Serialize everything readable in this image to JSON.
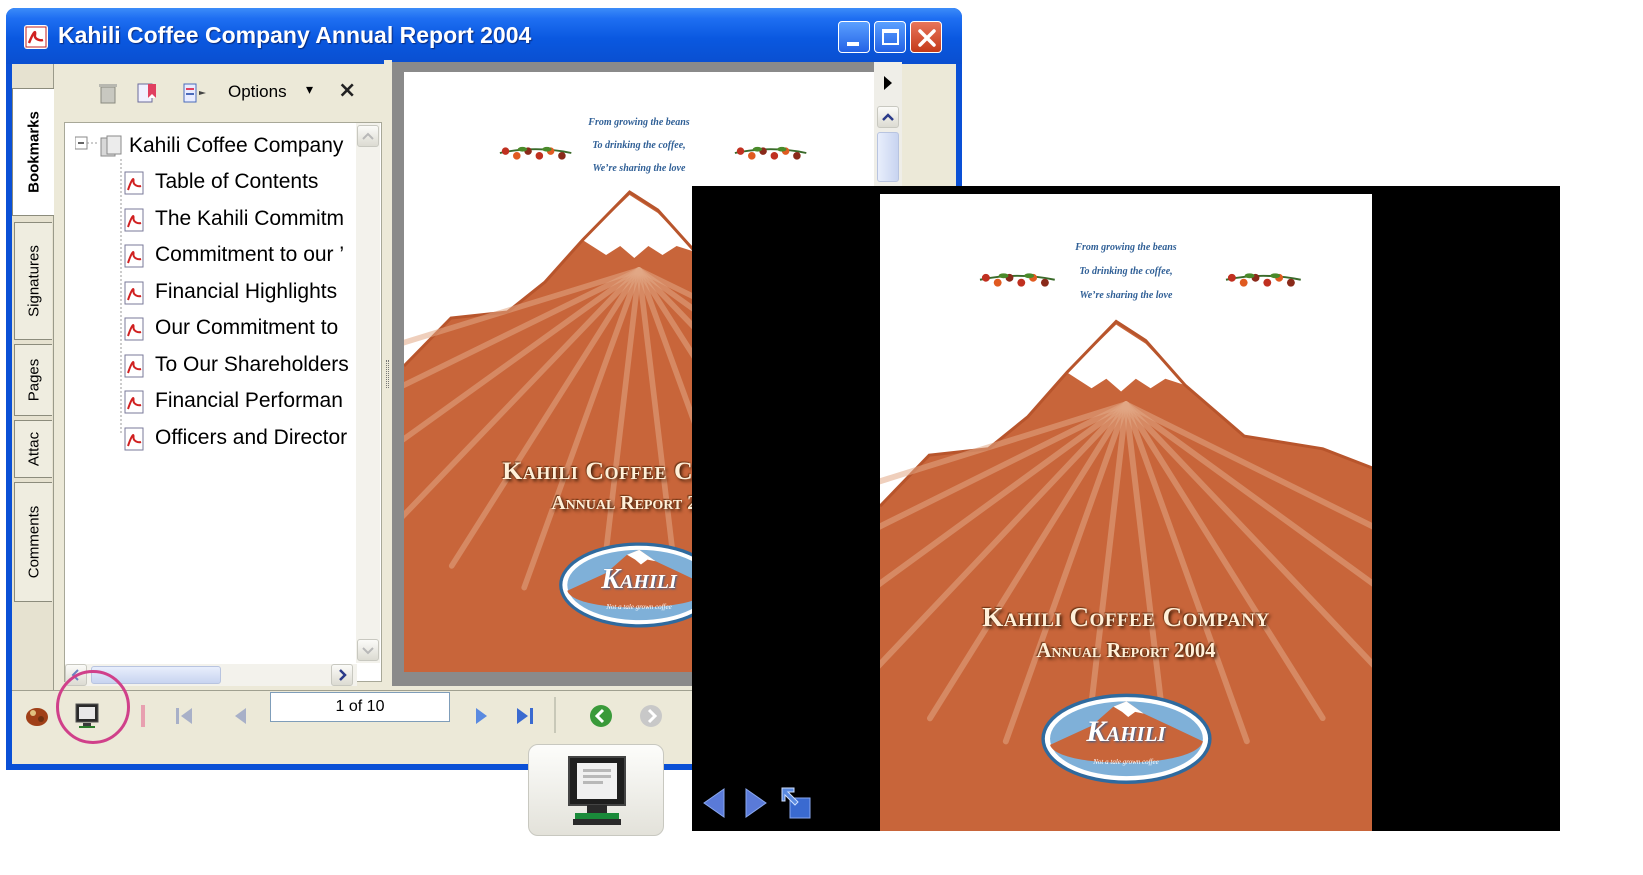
{
  "window": {
    "title": "Kahili Coffee Company Annual Report 2004"
  },
  "tabs": [
    {
      "label": "Bookmarks",
      "active": true
    },
    {
      "label": "Signatures",
      "active": false
    },
    {
      "label": "Pages",
      "active": false
    },
    {
      "label": "Attac",
      "active": false
    },
    {
      "label": "Comments",
      "active": false
    }
  ],
  "bookmarks_toolbar": {
    "delete_icon": "trash-icon",
    "new_bookmark_icon": "new-bookmark-icon",
    "expand_icon": "expand-bookmark-icon",
    "options_label": "Options",
    "close_icon": "close-icon"
  },
  "bookmarks": {
    "root": "Kahili Coffee Company",
    "items": [
      "Table of Contents",
      "The Kahili Commitm",
      "Commitment to our ’",
      "Financial Highlights",
      "Our Commitment to",
      "To Our Shareholders",
      "Financial Performan",
      "Officers and Director"
    ]
  },
  "navigation": {
    "page_display": "1 of 10"
  },
  "cover": {
    "tagline": [
      "From growing the beans",
      "To drinking the coffee,",
      "We’re sharing the love"
    ],
    "title": "Kahili Coffee Company",
    "subtitle": "Annual Report 2004",
    "logo_text": "Kahili",
    "logo_sub": "Not a tale grown coffee"
  },
  "colors": {
    "mountain": "#c8653a",
    "snow": "#ffffff",
    "title_bar": "#0a58e0",
    "highlight": "#d0408a"
  }
}
